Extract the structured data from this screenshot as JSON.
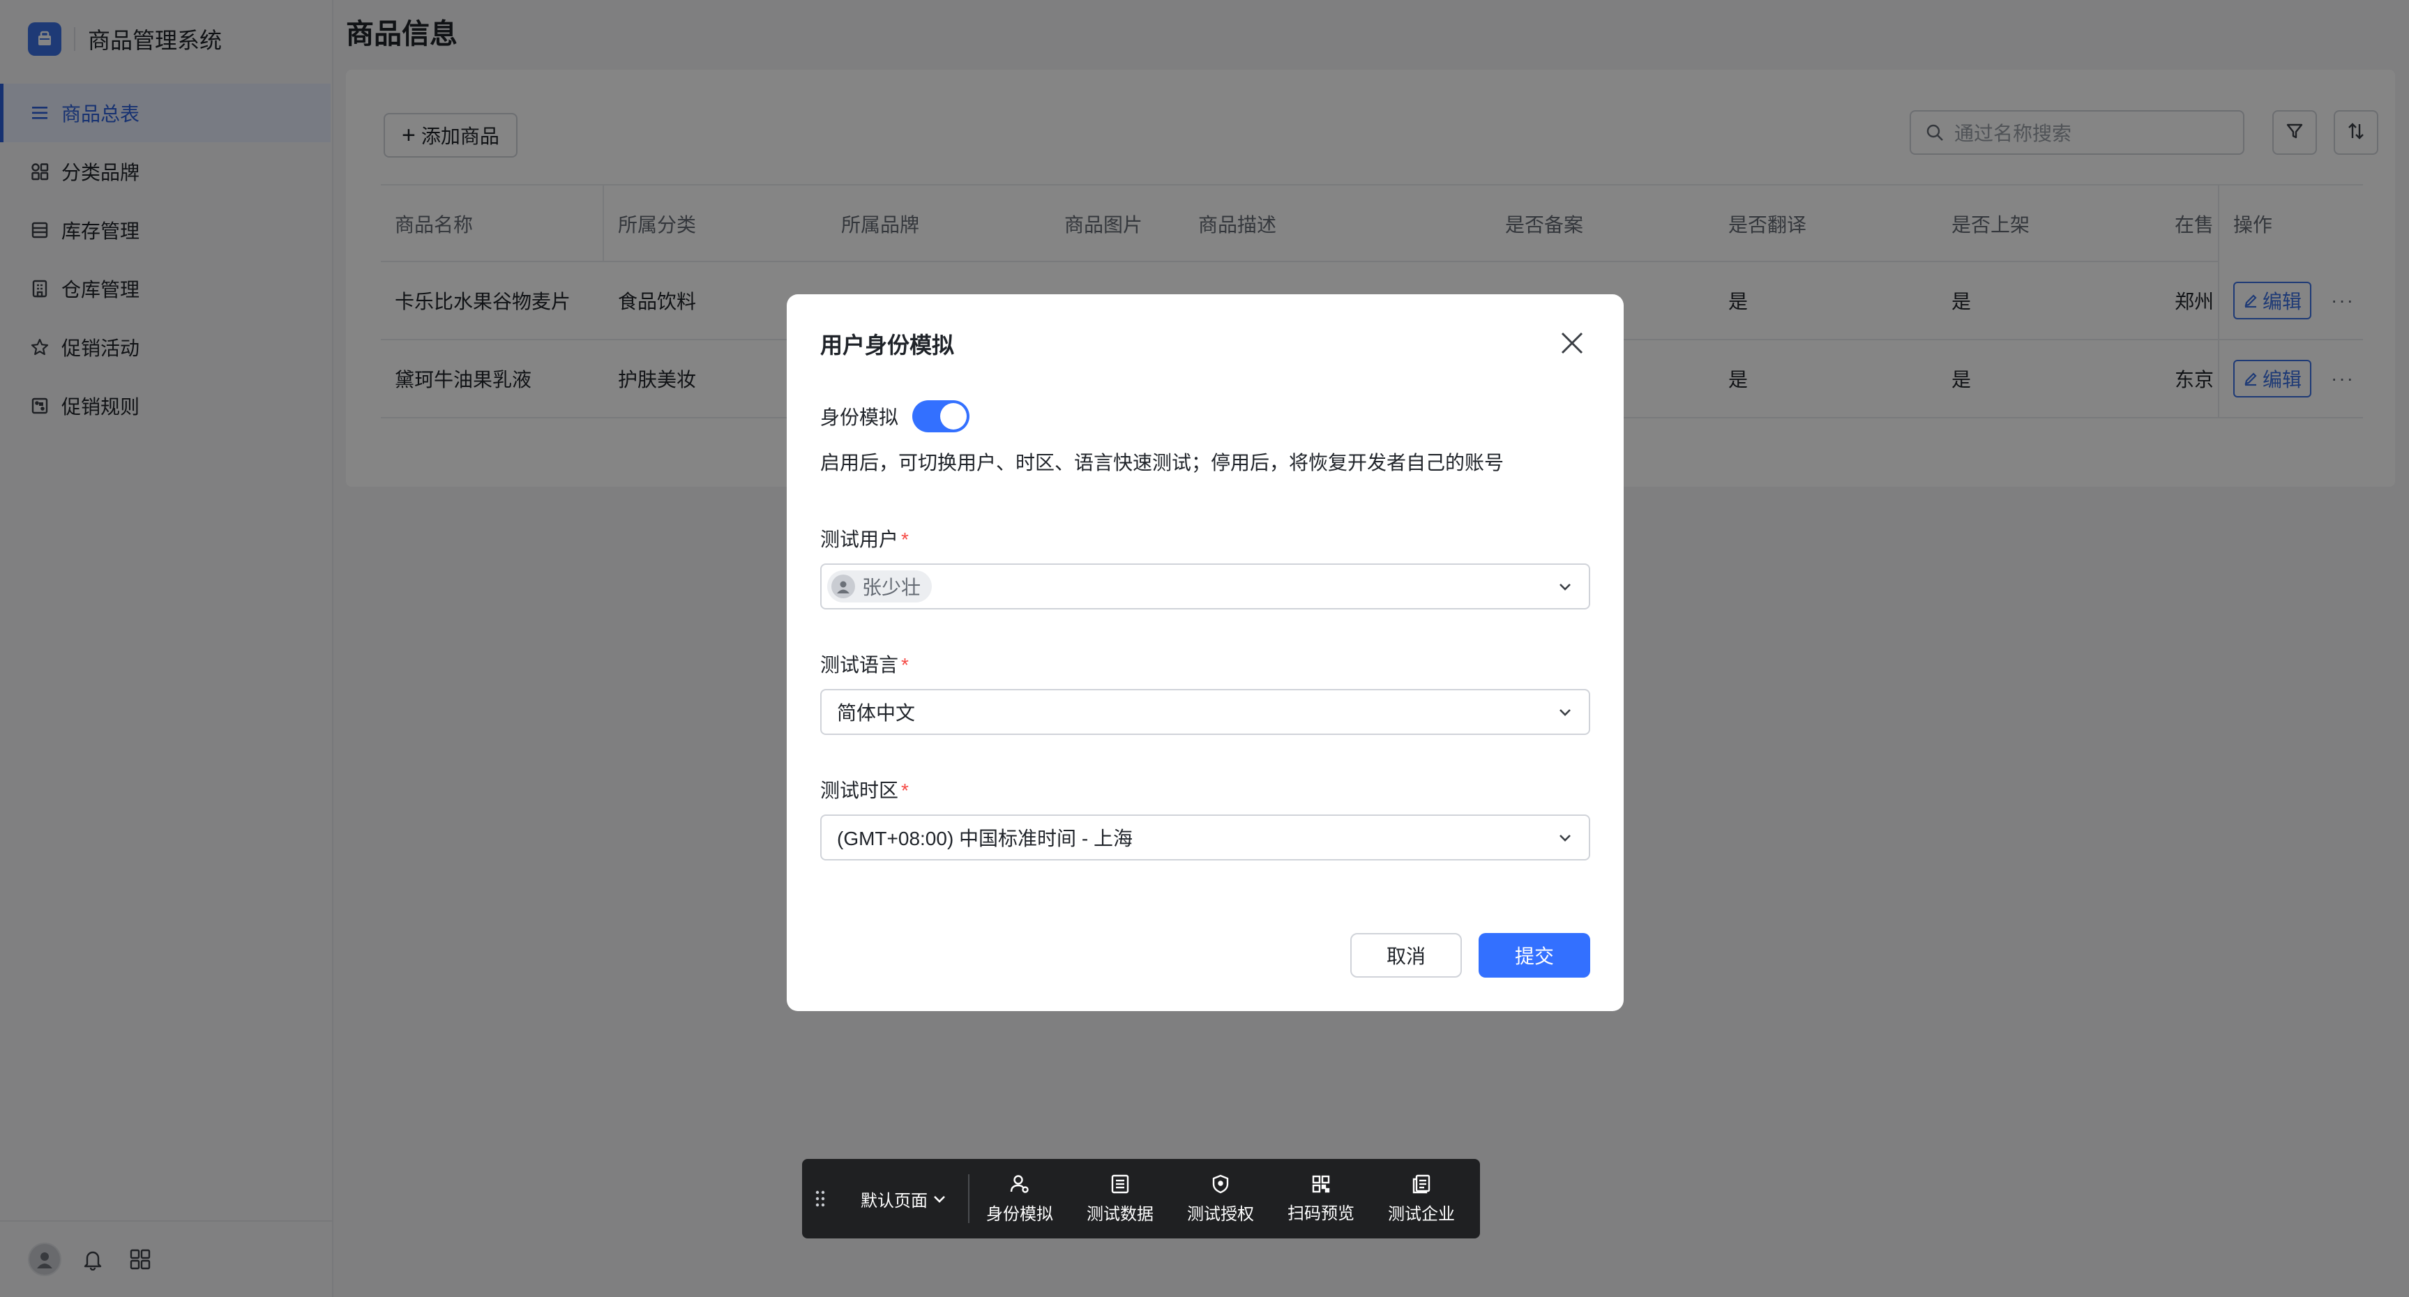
{
  "app": {
    "title": "商品管理系统"
  },
  "sidebar": {
    "items": [
      {
        "label": "商品总表",
        "icon": "list-icon",
        "active": true
      },
      {
        "label": "分类品牌",
        "icon": "grid-icon",
        "active": false
      },
      {
        "label": "库存管理",
        "icon": "stack-icon",
        "active": false
      },
      {
        "label": "仓库管理",
        "icon": "building-icon",
        "active": false
      },
      {
        "label": "促销活动",
        "icon": "star-icon",
        "active": false
      },
      {
        "label": "促销规则",
        "icon": "dice-icon",
        "active": false
      }
    ]
  },
  "page": {
    "title": "商品信息",
    "add_button": "添加商品",
    "search_placeholder": "通过名称搜索"
  },
  "table": {
    "headers": [
      "商品名称",
      "所属分类",
      "所属品牌",
      "商品图片",
      "商品描述",
      "是否备案",
      "是否翻译",
      "是否上架",
      "在售",
      "操作"
    ],
    "rows": [
      {
        "name": "卡乐比水果谷物麦片",
        "category": "食品饮料",
        "translated": "是",
        "listed": "是",
        "city": "郑州",
        "edit": "编辑",
        "more": "···"
      },
      {
        "name": "黛珂牛油果乳液",
        "category": "护肤美妆",
        "translated": "是",
        "listed": "是",
        "city": "东京",
        "edit": "编辑",
        "more": "···"
      }
    ]
  },
  "modal": {
    "title": "用户身份模拟",
    "toggle_label": "身份模拟",
    "toggle_on": true,
    "hint": "启用后，可切换用户、时区、语言快速测试；停用后，将恢复开发者自己的账号",
    "user_label": "测试用户",
    "user_value": "张少壮",
    "lang_label": "测试语言",
    "lang_value": "简体中文",
    "tz_label": "测试时区",
    "tz_value": "(GMT+08:00) 中国标准时间 - 上海",
    "required_mark": "*",
    "cancel": "取消",
    "submit": "提交"
  },
  "devbar": {
    "page_select": "默认页面",
    "tools": [
      {
        "label": "身份模拟",
        "icon": "user-icon"
      },
      {
        "label": "测试数据",
        "icon": "data-icon"
      },
      {
        "label": "测试授权",
        "icon": "shield-icon"
      },
      {
        "label": "扫码预览",
        "icon": "qrcode-icon"
      },
      {
        "label": "测试企业",
        "icon": "company-icon"
      }
    ]
  },
  "colors": {
    "accent": "#3370ff",
    "danger": "#f54a45",
    "nav_active": "#2b5fd9"
  }
}
